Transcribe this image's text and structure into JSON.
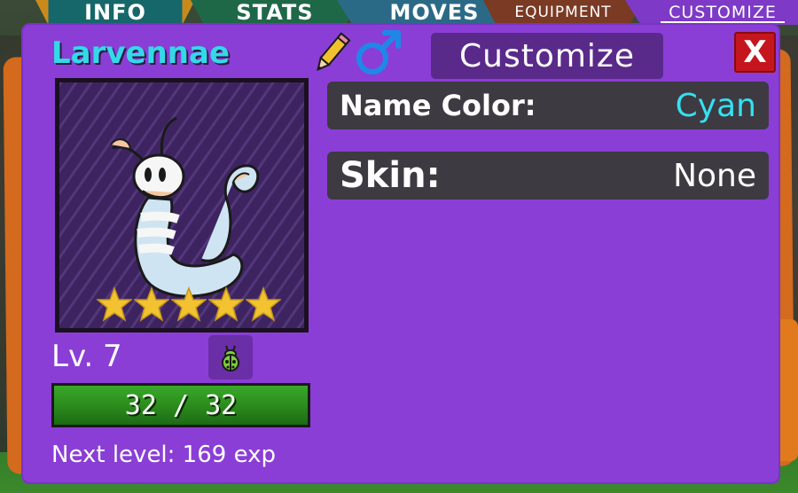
{
  "tabs": [
    {
      "label": "INFO"
    },
    {
      "label": "STATS"
    },
    {
      "label": "MOVES"
    },
    {
      "label": "EQUIPMENT"
    },
    {
      "label": "CUSTOMIZE",
      "active": true
    }
  ],
  "creature": {
    "name": "Larvennae",
    "name_color": "#34d9e8",
    "gender_icon": "male-symbol-icon",
    "stars": 5,
    "level_label": "Lv. 7",
    "type_icon": "bug-type-icon",
    "hp_text": "32 / 32",
    "hp_fraction": 1.0,
    "next_level_text": "Next level: 169 exp"
  },
  "customize": {
    "title": "Customize",
    "close_label": "X",
    "name_color_label": "Name Color:",
    "name_color_value": "Cyan",
    "skin_label": "Skin:",
    "skin_value": "None"
  },
  "colors": {
    "panel": "#8a3ed6",
    "accent_cyan": "#34d9e8",
    "close_red": "#c4161c",
    "hp_green": "#2a8a1c"
  }
}
